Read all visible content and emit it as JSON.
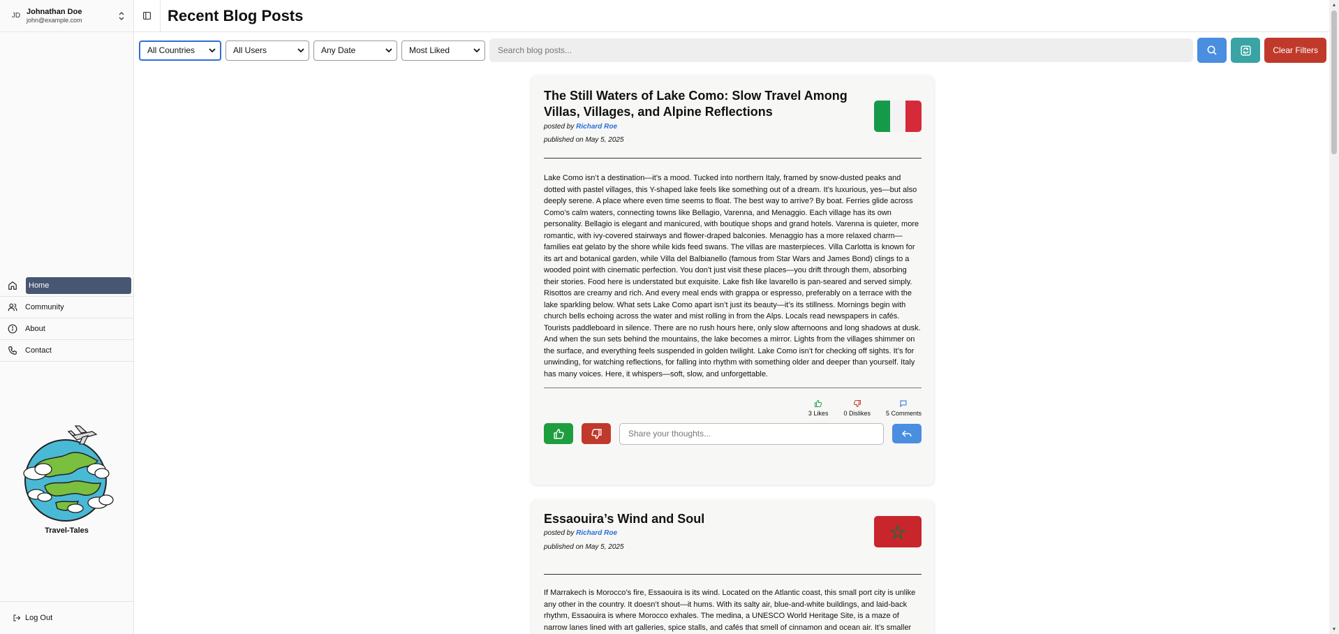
{
  "user": {
    "initials": "JD",
    "name": "Johnathan Doe",
    "email": "john@example.com"
  },
  "nav": {
    "items": [
      {
        "label": "Home",
        "icon": "home-icon",
        "active": true
      },
      {
        "label": "Community",
        "icon": "users-icon"
      },
      {
        "label": "About",
        "icon": "info-icon"
      },
      {
        "label": "Contact",
        "icon": "phone-icon"
      }
    ]
  },
  "brand": {
    "name": "Travel-Tales"
  },
  "logout": {
    "label": "Log Out"
  },
  "header": {
    "title": "Recent Blog Posts"
  },
  "filters": {
    "country": "All Countries",
    "users": "All Users",
    "date": "Any Date",
    "sort": "Most Liked",
    "search_placeholder": "Search blog posts...",
    "clear_label": "Clear Filters"
  },
  "colors": {
    "accent": "#475672",
    "search_btn": "#4a8ee0",
    "refresh_btn": "#3aa3a3",
    "clear_btn": "#c0392b",
    "like": "#1e9e3e",
    "dislike": "#c0392b"
  },
  "posts": [
    {
      "title": "The Still Waters of Lake Como: Slow Travel Among Villas, Villages, and Alpine Reflections",
      "posted_by_prefix": "posted by",
      "author": "Richard Roe",
      "published": "published on May 5, 2025",
      "flag": "italy",
      "body": "Lake Como isn’t a destination—it’s a mood. Tucked into northern Italy, framed by snow-dusted peaks and dotted with pastel villages, this Y-shaped lake feels like something out of a dream. It’s luxurious, yes—but also deeply serene. A place where even time seems to float. The best way to arrive? By boat. Ferries glide across Como’s calm waters, connecting towns like Bellagio, Varenna, and Menaggio. Each village has its own personality. Bellagio is elegant and manicured, with boutique shops and grand hotels. Varenna is quieter, more romantic, with ivy-covered stairways and flower-draped balconies. Menaggio has a more relaxed charm—families eat gelato by the shore while kids feed swans. The villas are masterpieces. Villa Carlotta is known for its art and botanical garden, while Villa del Balbianello (famous from Star Wars and James Bond) clings to a wooded point with cinematic perfection. You don’t just visit these places—you drift through them, absorbing their stories. Food here is understated but exquisite. Lake fish like lavarello is pan-seared and served simply. Risottos are creamy and rich. And every meal ends with grappa or espresso, preferably on a terrace with the lake sparkling below. What sets Lake Como apart isn’t just its beauty—it’s its stillness. Mornings begin with church bells echoing across the water and mist rolling in from the Alps. Locals read newspapers in cafés. Tourists paddleboard in silence. There are no rush hours here, only slow afternoons and long shadows at dusk. And when the sun sets behind the mountains, the lake becomes a mirror. Lights from the villages shimmer on the surface, and everything feels suspended in golden twilight. Lake Como isn’t for checking off sights. It’s for unwinding, for watching reflections, for falling into rhythm with something older and deeper than yourself. Italy has many voices. Here, it whispers—soft, slow, and unforgettable.",
      "likes": "3 Likes",
      "dislikes": "0 Dislikes",
      "comments": "5 Comments",
      "thoughts_placeholder": "Share your thoughts..."
    },
    {
      "title": "Essaouira’s Wind and Soul",
      "posted_by_prefix": "posted by",
      "author": "Richard Roe",
      "published": "published on May 5, 2025",
      "flag": "morocco",
      "body": "If Marrakech is Morocco’s fire, Essaouira is its wind. Located on the Atlantic coast, this small port city is unlike any other in the country. It doesn’t shout—it hums. With its salty air, blue-and-white buildings, and laid-back rhythm, Essaouira is where Morocco exhales. The medina, a UNESCO World Heritage Site, is a maze of narrow lanes lined with art galleries, spice stalls, and cafés that smell of cinnamon and ocean air. It’s smaller and calmer than the medinas of Marrakech or Fes, and that’s the"
    }
  ]
}
